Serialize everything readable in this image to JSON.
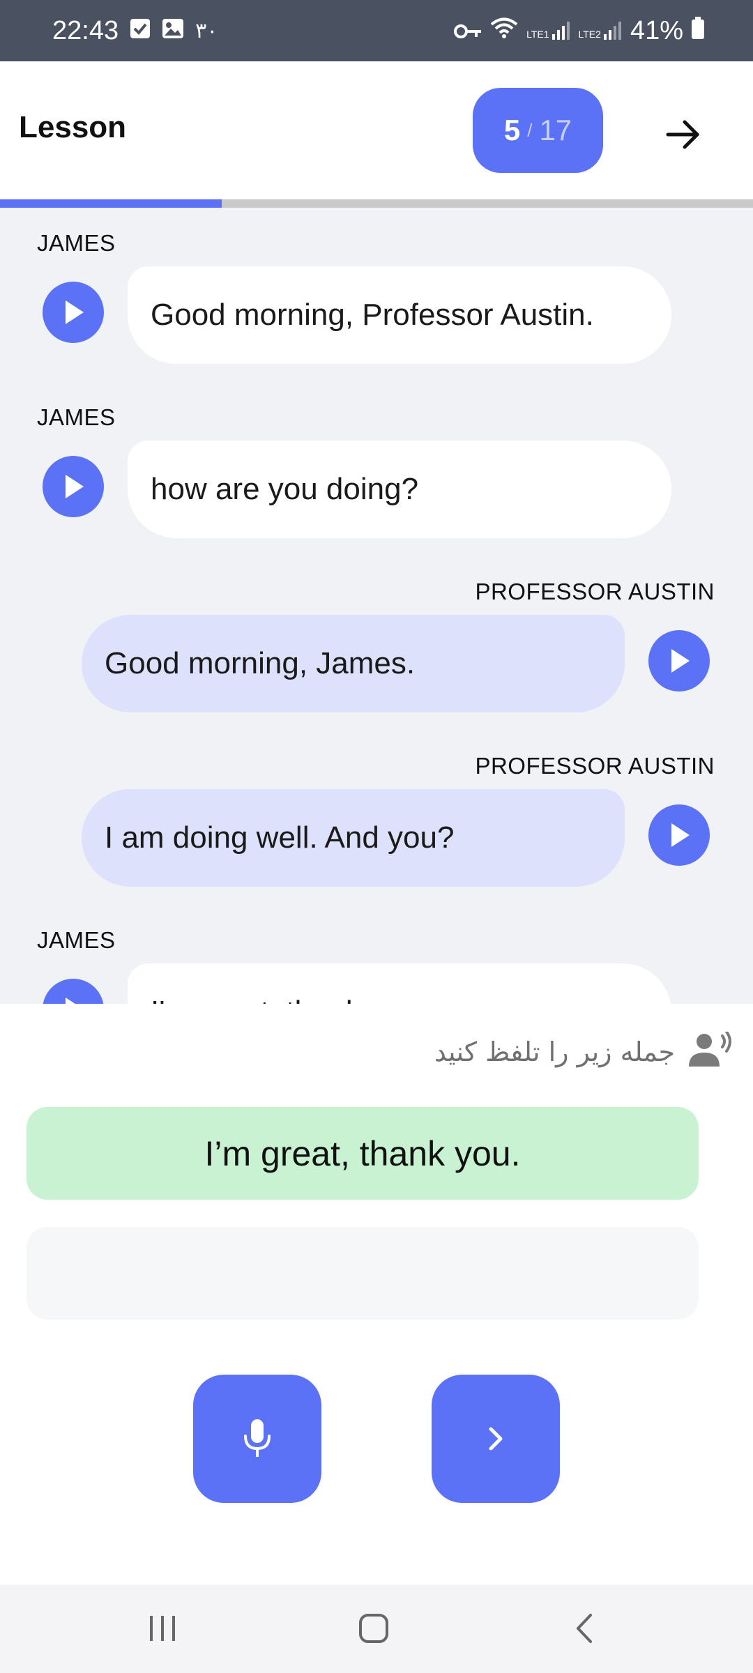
{
  "status_bar": {
    "time": "22:43",
    "date_digits": "۳۰",
    "battery": "41%",
    "sim1_label": "LTE1",
    "sim2_label": "LTE2"
  },
  "header": {
    "title": "Lesson",
    "progress_current": "5",
    "progress_separator": "/",
    "progress_total": "17",
    "progress_fraction": 0.294
  },
  "messages": [
    {
      "speaker": "JAMES",
      "text": "Good morning, Professor Austin.",
      "side": "left"
    },
    {
      "speaker": "JAMES",
      "text": "how are you doing?",
      "side": "left"
    },
    {
      "speaker": "PROFESSOR AUSTIN",
      "text": "Good morning, James.",
      "side": "right"
    },
    {
      "speaker": "PROFESSOR AUSTIN",
      "text": "I am doing well. And you?",
      "side": "right"
    },
    {
      "speaker": "JAMES",
      "text": "I'm great, thank you.",
      "side": "left"
    }
  ],
  "practice": {
    "instruction": "جمله زیر را تلفظ کنید",
    "target_sentence": "I’m great, thank you.",
    "result_text": ""
  },
  "colors": {
    "accent": "#5b72f7",
    "james_bubble": "#ffffff",
    "professor_bubble": "#dde1fb",
    "target_bg": "#c8f2d1",
    "status_bar_bg": "#4a5160"
  },
  "icons": {
    "play": "play-icon",
    "mic": "microphone-icon",
    "next": "chevron-right-icon",
    "header_next": "arrow-right-icon",
    "speaker": "speaking-person-icon"
  }
}
